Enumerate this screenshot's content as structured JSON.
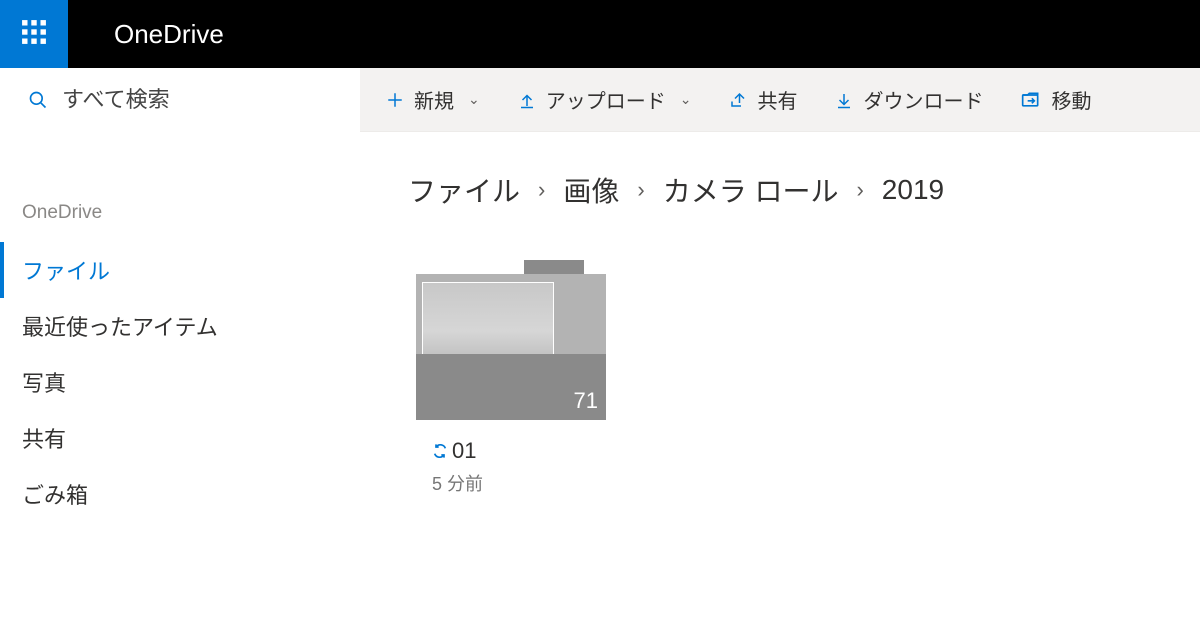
{
  "header": {
    "app_title": "OneDrive"
  },
  "search": {
    "placeholder": "すべて検索"
  },
  "sidebar": {
    "heading": "OneDrive",
    "items": [
      {
        "label": "ファイル",
        "selected": true
      },
      {
        "label": "最近使ったアイテム",
        "selected": false
      },
      {
        "label": "写真",
        "selected": false
      },
      {
        "label": "共有",
        "selected": false
      },
      {
        "label": "ごみ箱",
        "selected": false
      }
    ]
  },
  "commands": {
    "new_label": "新規",
    "upload_label": "アップロード",
    "share_label": "共有",
    "download_label": "ダウンロード",
    "move_label": "移動"
  },
  "breadcrumb": [
    {
      "label": "ファイル"
    },
    {
      "label": "画像"
    },
    {
      "label": "カメラ ロール"
    },
    {
      "label": "2019"
    }
  ],
  "items": [
    {
      "name": "01",
      "count": "71",
      "modified": "5 分前"
    }
  ]
}
